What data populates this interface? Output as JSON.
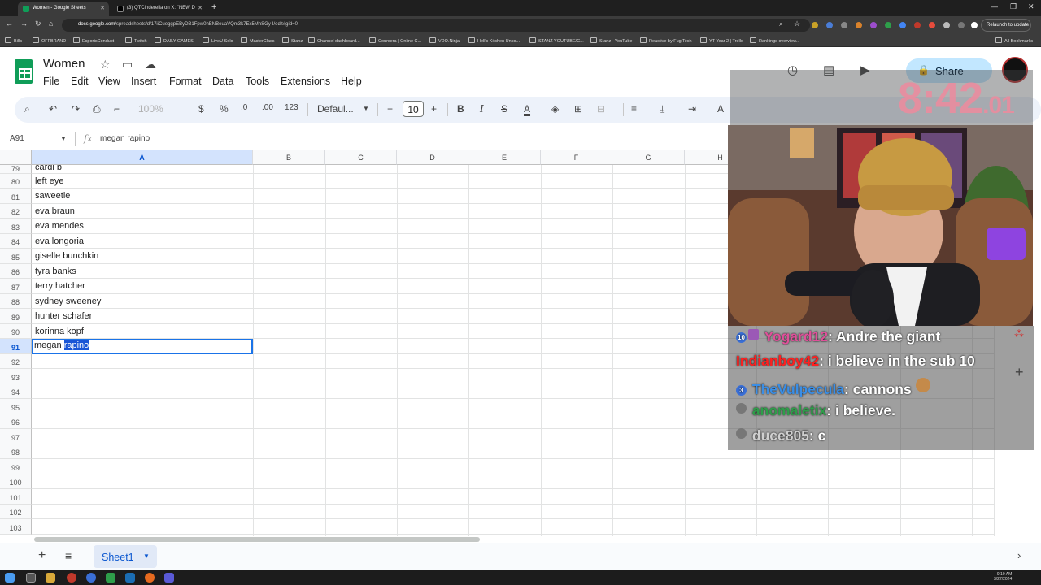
{
  "browser": {
    "tabs": [
      {
        "title": "Women - Google Sheets",
        "active": true
      },
      {
        "title": "(3) QTCinderella on X: \"NEW D",
        "active": false
      }
    ],
    "url_host": "docs.google.com",
    "url_path": "/spreadsheets/d/17iiCueggpEByDB1Fpw0hBNBeuaVQm3k7Ex5MhSGy-I/edit#gid=0",
    "relaunch_label": "Relaunch to update",
    "bookmarks": [
      "Bills",
      "OFFBRAND",
      "EsportsConduct",
      "Twitch",
      "DAILY GAMES",
      "LiveU Solo",
      "MasterClass",
      "Stanz",
      "Channel dashboard...",
      "Coursera | Online C...",
      "VDO.Ninja",
      "Hell's Kitchen Unco...",
      "STANZ YOUTUBE/C...",
      "Stanz - YouTube",
      "Reactive by FugiTech",
      "YT Year 2 | Trello",
      "Rankings overview...",
      "All Bookmarks"
    ]
  },
  "doc": {
    "title": "Women",
    "menu": [
      "File",
      "Edit",
      "View",
      "Insert",
      "Format",
      "Data",
      "Tools",
      "Extensions",
      "Help"
    ],
    "share_label": "Share"
  },
  "toolbar": {
    "zoom": "100%",
    "currency": "$",
    "percent": "%",
    "dec_decrease": ".0",
    "dec_increase": ".00",
    "number_format": "123",
    "font": "Defaul...",
    "font_size": "10",
    "bold": "B",
    "italic": "I",
    "strike": "S",
    "text_color": "A"
  },
  "formula_bar": {
    "name_box": "A91",
    "fx": "fx",
    "content": "megan rapino"
  },
  "columns": [
    "A",
    "B",
    "C",
    "D",
    "E",
    "F",
    "G",
    "H"
  ],
  "rows": [
    {
      "num": "79",
      "a": "cardi b"
    },
    {
      "num": "80",
      "a": "left eye"
    },
    {
      "num": "81",
      "a": "saweetie"
    },
    {
      "num": "82",
      "a": "eva braun"
    },
    {
      "num": "83",
      "a": "eva mendes"
    },
    {
      "num": "84",
      "a": "eva longoria"
    },
    {
      "num": "85",
      "a": "giselle bunchkin"
    },
    {
      "num": "86",
      "a": "tyra banks"
    },
    {
      "num": "87",
      "a": "terry hatcher"
    },
    {
      "num": "88",
      "a": "sydney sweeney"
    },
    {
      "num": "89",
      "a": "hunter schafer"
    },
    {
      "num": "90",
      "a": "korinna kopf"
    },
    {
      "num": "91",
      "a": "megan rapino"
    },
    {
      "num": "92",
      "a": ""
    },
    {
      "num": "93",
      "a": ""
    },
    {
      "num": "94",
      "a": ""
    },
    {
      "num": "95",
      "a": ""
    },
    {
      "num": "96",
      "a": ""
    },
    {
      "num": "97",
      "a": ""
    },
    {
      "num": "98",
      "a": ""
    },
    {
      "num": "99",
      "a": ""
    },
    {
      "num": "100",
      "a": ""
    },
    {
      "num": "101",
      "a": ""
    },
    {
      "num": "102",
      "a": ""
    },
    {
      "num": "103",
      "a": ""
    }
  ],
  "active_cell": {
    "ref": "A91",
    "text_plain": "megan ",
    "text_selected": "rapino"
  },
  "sheet_tabs": [
    "Sheet1"
  ],
  "taskbar": {
    "time": "9:19 AM",
    "date": "3/27/2024"
  },
  "overlay": {
    "timer_main": "8:42",
    "timer_fraction": ".01",
    "chat": [
      {
        "badge": "10",
        "user": "Yogard12",
        "user_color": "#e0509a",
        "text": "Andre the giant"
      },
      {
        "badge": "",
        "user": "Indianboy42",
        "user_color": "#ff2020",
        "text": "i believe in the sub 10"
      },
      {
        "badge": "3",
        "user": "TheVulpecula",
        "user_color": "#3a8ee6",
        "text": "cannons"
      },
      {
        "badge": "",
        "user": "anomaletix",
        "user_color": "#2e9e4a",
        "text": "i believe."
      },
      {
        "badge": "",
        "user": "duce805",
        "user_color": "#cfcfcf",
        "text": "c"
      }
    ]
  }
}
